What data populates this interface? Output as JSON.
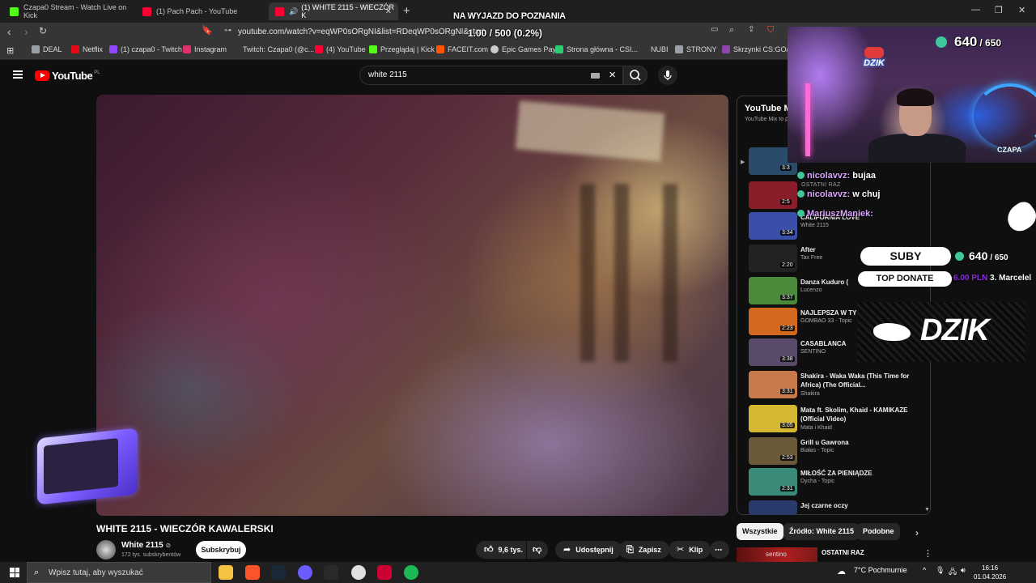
{
  "tabs": [
    {
      "title": "Czapa0 Stream - Watch Live on Kick",
      "color": "#53fc18"
    },
    {
      "title": "(1) Pach Pach - YouTube",
      "color": "#ff0033"
    },
    {
      "title": "(1) WHITE 2115 - WIECZÓR K",
      "color": "#ff0033",
      "close": "✕"
    }
  ],
  "browser": {
    "url": "youtube.com/watch?v=eqWP0sORgNI&list=RDeqWP0sORgNI&start",
    "new_tab": "+",
    "minimize": "—",
    "restore": "❐",
    "close": "✕"
  },
  "bookmarks": [
    {
      "label": "DEAL",
      "color": "#9aa0a6"
    },
    {
      "label": "Netflix",
      "color": "#e50914"
    },
    {
      "label": "(1) czapa0 - Twitch",
      "color": "#9146ff"
    },
    {
      "label": "Instagram",
      "color": "#e1306c"
    },
    {
      "label": "Twitch: Czapa0 (@c...",
      "color": "#333333"
    },
    {
      "label": "(4) YouTube",
      "color": "#ff0033"
    },
    {
      "label": "Przeglądaj | Kick",
      "color": "#53fc18"
    },
    {
      "label": "FACEIT.com",
      "color": "#ff5500"
    },
    {
      "label": "Epic Games Pay",
      "color": "#cccccc"
    },
    {
      "label": "Strona główna - CSI...",
      "color": "#2ecc71"
    },
    {
      "label": "NUBI",
      "color": "#353535"
    },
    {
      "label": "STRONY",
      "color": "#9aa0a6"
    },
    {
      "label": "Skrzynki CS:GO/CS2",
      "color": "#8e44ad"
    }
  ],
  "youtube": {
    "logo_text": "YouTube",
    "logo_country": "PL",
    "search_value": "white 2115",
    "video_title": "WHITE 2115 - WIECZÓR KAWALERSKI",
    "channel_name": "White 2115",
    "verified": "⊘",
    "channel_subs": "172 tys. subskrybentów",
    "subscribe_label": "Subskrybuj",
    "actions": {
      "likes": "9,6 tys.",
      "share": "Udostępnij",
      "save": "Zapisz",
      "clip": "Klip",
      "more": "⋯"
    }
  },
  "playlist": {
    "title": "YouTube M",
    "subtitle": "YouTube Mix to p",
    "current_marker": "▶",
    "scroll_marker": "▼",
    "items": [
      {
        "title": "",
        "channel": "",
        "duration": "3:3",
        "color": "#2b4b6a"
      },
      {
        "title": "",
        "channel": "",
        "duration": "2:5",
        "color": "#8a1d2a"
      },
      {
        "title": "CALIFORNIA LOVE",
        "channel": "White 2115",
        "duration": "3:34",
        "color": "#3a4fa8"
      },
      {
        "title": "After",
        "channel": "Tax Free",
        "duration": "2:20",
        "color": "#222222"
      },
      {
        "title": "Danza Kuduro (",
        "channel": "Lucenzo",
        "duration": "3:37",
        "color": "#4a8a3a"
      },
      {
        "title": "NAJLEPSZA W TY",
        "channel": "GOMBAO 33 - Topic",
        "duration": "2:23",
        "color": "#d2691e"
      },
      {
        "title": "CASABLANCA",
        "channel": "SENTINO",
        "duration": "3:38",
        "color": "#5a4a6a"
      },
      {
        "title": "Shakira - Waka Waka (This Time for Africa) (The Official...",
        "channel": "Shakira",
        "duration": "3:31",
        "color": "#c97a4a"
      },
      {
        "title": "Mata ft. Skolim, Khaid - KAMIKAZE (Official Video)",
        "channel": "Mata i Khaid",
        "duration": "3:05",
        "color": "#d4b832"
      },
      {
        "title": "Grill u Gawrona",
        "channel": "Białas - Topic",
        "duration": "2:53",
        "color": "#6a5a3a"
      },
      {
        "title": "MIŁOŚĆ ZA PIENIĄDZE",
        "channel": "Dycha - Topic",
        "duration": "2:31",
        "color": "#3a8a7a"
      },
      {
        "title": "Jej czarne oczy",
        "channel": "",
        "duration": "",
        "color": "#2a3a6a"
      }
    ]
  },
  "chips": [
    "Wszystkie",
    "Źródło: White 2115",
    "Podobne"
  ],
  "chip_next": "›",
  "next_item": {
    "label": "sentino",
    "title": "OSTATNI RAZ",
    "more": "⋮"
  },
  "overlay": {
    "top_text": "NA WYJAZD DO POZNANIA",
    "goal_text": "1.00 / 500 (0.2%)",
    "cam_counter": "640",
    "cam_counter_max": "/ 650",
    "cam_logo": "DZIK",
    "cam_name": "CZAPA",
    "chat_ghost": "OSTATNI RAZ",
    "chat": [
      {
        "user": "nicolavvz:",
        "msg": "bujaa"
      },
      {
        "user": "nicolavvz:",
        "msg": "w chuj"
      },
      {
        "user": "MariuszManiek:",
        "msg": ""
      }
    ],
    "suby_label": "SUBY",
    "suby_count": "640",
    "suby_max": "/ 650",
    "top_donate_label": "TOP DONATE",
    "donor_amount": "6.00 PLN",
    "donor_name": "3. Marcelel",
    "banner_text": "DZIK"
  },
  "taskbar": {
    "search_placeholder": "Wpisz tutaj, aby wyszukać",
    "weather": "7°C  Pochmurnie",
    "time": "16:16",
    "date": "01.04.2026",
    "apps": [
      {
        "color": "#f5c242"
      },
      {
        "color": "#fb542b"
      },
      {
        "color": "#1b2838"
      },
      {
        "color": "#6a5cff"
      },
      {
        "color": "#2a2a2a"
      },
      {
        "color": "#e0e0e0"
      },
      {
        "color": "#cc0033"
      },
      {
        "color": "#1db954"
      }
    ]
  }
}
